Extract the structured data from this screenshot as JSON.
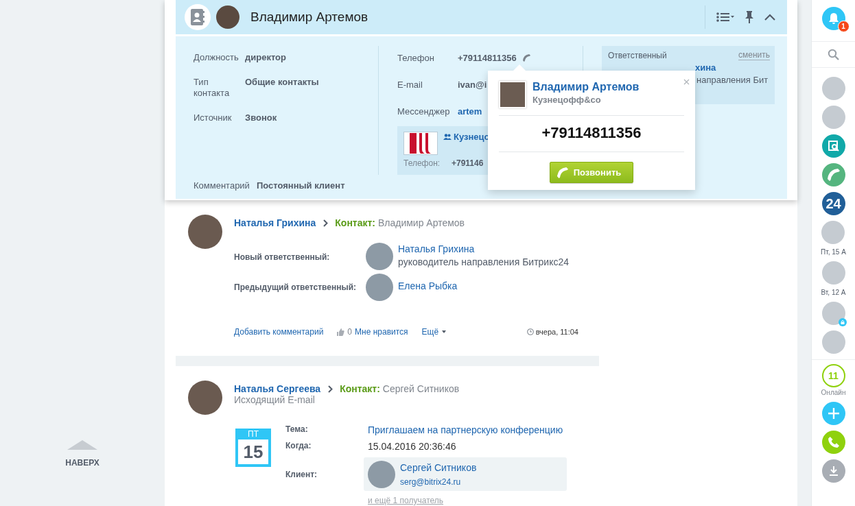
{
  "scroll_top": {
    "label": "НАВЕРХ"
  },
  "contact_card": {
    "title": "Владимир Артемов",
    "fields": [
      {
        "label": "Должность",
        "value": "директор"
      },
      {
        "label": "Тип контакта",
        "value": "Общие контакты"
      },
      {
        "label": "Источник",
        "value": "Звонок"
      }
    ],
    "contacts": [
      {
        "label": "Телефон",
        "value": "+79114811356",
        "kind": "phone"
      },
      {
        "label": "E-mail",
        "value": "ivan@i",
        "kind": "text"
      },
      {
        "label": "Мессенджер",
        "value": "artem",
        "kind": "link"
      }
    ],
    "company": {
      "name": "Кузнецо",
      "phone_label": "Телефон:",
      "phone": "+791146"
    },
    "responsible": {
      "label": "Ответственный",
      "action": "сменить",
      "name": "хина",
      "position": "направления Бит"
    },
    "comment": {
      "label": "Комментарий",
      "value": "Постоянный клиент"
    }
  },
  "call_popup": {
    "name": "Владимир Артемов",
    "company": "Кузнецофф&co",
    "phone": "+79114811356",
    "button": "Позвонить"
  },
  "feed": [
    {
      "kind": "responsible_change",
      "author": "Наталья Грихина",
      "entity_label": "Контакт:",
      "entity": "Владимир Артемов",
      "rows": [
        {
          "label": "Новый ответственный:",
          "name": "Наталья Грихина",
          "position": "руководитель направления Битрикс24"
        },
        {
          "label": "Предыдущий ответственный:",
          "name": "Елена Рыбка"
        }
      ],
      "footer": {
        "comment": "Добавить комментарий",
        "likes": "0",
        "like": "Мне нравится",
        "more": "Ещё",
        "time": "вчера, 11:04"
      }
    },
    {
      "kind": "email",
      "author": "Наталья Сергеева",
      "entity_label": "Контакт:",
      "entity": "Сергей Ситников",
      "subtitle": "Исходящий E-mail",
      "calendar": {
        "weekday": "ПТ",
        "day": "15"
      },
      "subject_label": "Тема:",
      "subject": "Приглашаем на партнерскую конференцию",
      "when_label": "Когда:",
      "when": "15.04.2016 20:36:46",
      "client_label": "Клиент:",
      "client": {
        "name": "Сергей Ситников",
        "email": "serg@bitrix24.ru"
      },
      "more_recipients": "и ещё 1 получатель"
    }
  ],
  "sidebar": [
    {
      "kind": "notifications",
      "badge": "1"
    },
    {
      "kind": "search"
    },
    {
      "kind": "avatar",
      "locked": false
    },
    {
      "kind": "avatar",
      "locked": false
    },
    {
      "kind": "documents"
    },
    {
      "kind": "phone"
    },
    {
      "kind": "logo",
      "text": "24"
    },
    {
      "kind": "avatar",
      "locked": false,
      "caption": "Пт, 15 А"
    },
    {
      "kind": "avatar",
      "locked": false,
      "caption": "Вт, 12 А"
    },
    {
      "kind": "avatar",
      "locked": true
    },
    {
      "kind": "avatar",
      "locked": false
    },
    {
      "kind": "online",
      "count": "11",
      "caption": "Онлайн"
    },
    {
      "kind": "add"
    },
    {
      "kind": "call"
    },
    {
      "kind": "download"
    }
  ]
}
